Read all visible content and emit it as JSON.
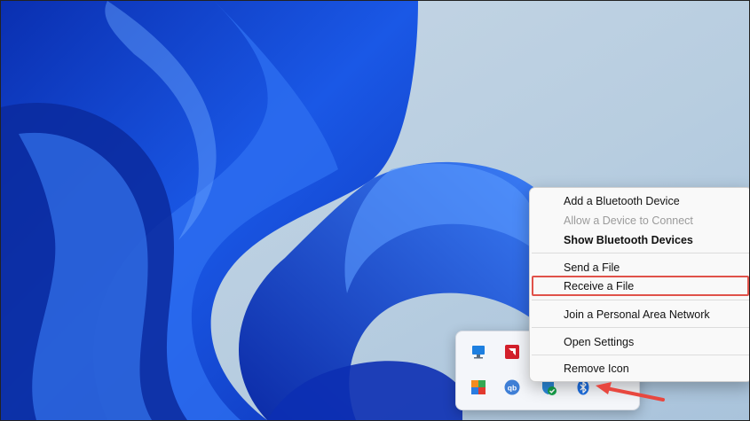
{
  "bluetooth_menu": {
    "items": [
      {
        "label": "Add a Bluetooth Device",
        "state": "enabled"
      },
      {
        "label": "Allow a Device to Connect",
        "state": "disabled"
      },
      {
        "label": "Show Bluetooth Devices",
        "state": "bold"
      },
      {
        "label": "Send a File",
        "state": "enabled"
      },
      {
        "label": "Receive a File",
        "state": "highlighted"
      },
      {
        "label": "Join a Personal Area Network",
        "state": "enabled"
      },
      {
        "label": "Open Settings",
        "state": "enabled"
      },
      {
        "label": "Remove Icon",
        "state": "enabled"
      }
    ]
  },
  "tray_overflow": {
    "icons": [
      "monitor-icon",
      "amd-icon",
      "app-grid-icon",
      "qbittorrent-icon",
      "defender-icon",
      "bluetooth-icon"
    ]
  },
  "colors": {
    "highlight_outline": "#e0524a",
    "annotation_arrow": "#e8473f",
    "wallpaper_blue": "#1546d6"
  }
}
